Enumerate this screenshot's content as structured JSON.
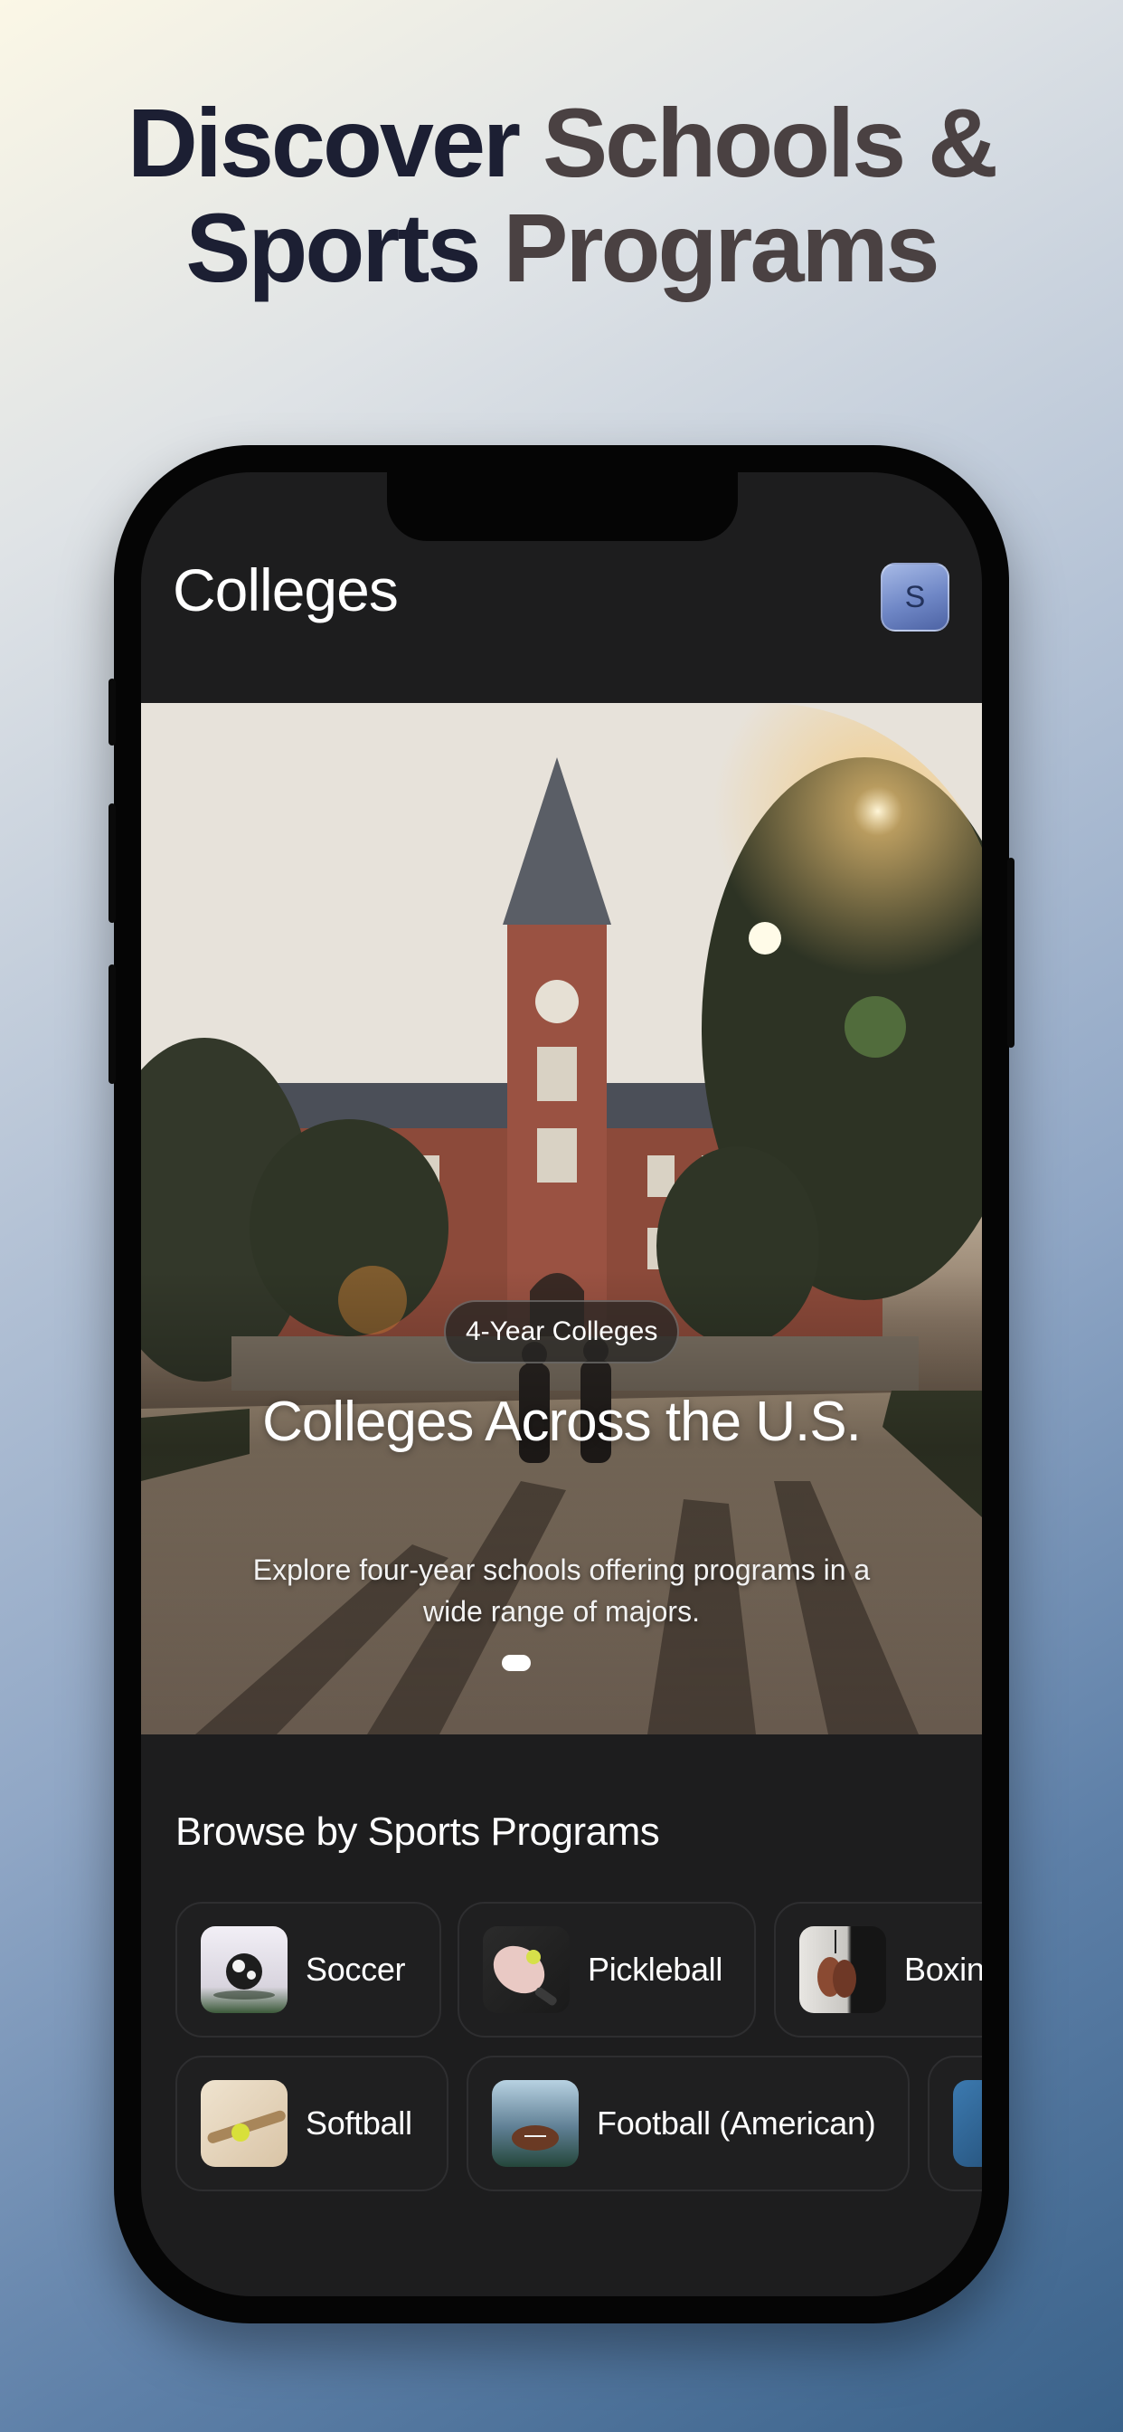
{
  "headline": {
    "line1_part1": "Discover",
    "line1_part2": "Schools &",
    "line2_part1": "Sports",
    "line2_part2": "Programs"
  },
  "header": {
    "title": "Colleges",
    "avatar_initial": "S"
  },
  "hero": {
    "badge": "4-Year Colleges",
    "title": "Colleges Across the U.S.",
    "subtitle": "Explore four-year schools offering programs in a wide range of majors.",
    "page_indicator": {
      "count": 1,
      "active": 1
    }
  },
  "sports_section": {
    "title": "Browse by Sports Programs",
    "row1": [
      {
        "label": "Soccer",
        "icon": "soccer-ball-photo"
      },
      {
        "label": "Pickleball",
        "icon": "pickleball-paddle-photo"
      },
      {
        "label": "Boxin",
        "icon": "boxing-gloves-photo"
      }
    ],
    "row2": [
      {
        "label": "Softball",
        "icon": "softball-bat-photo"
      },
      {
        "label": "Football (American)",
        "icon": "american-football-photo"
      },
      {
        "label": "",
        "icon": "sport-photo"
      }
    ]
  },
  "colors": {
    "app_background": "#1d1d1e",
    "chip_background": "#1f1f20",
    "headline_dark": "#1c1f33",
    "headline_brown": "#4a4142",
    "avatar_accent": "#6f87c6"
  }
}
